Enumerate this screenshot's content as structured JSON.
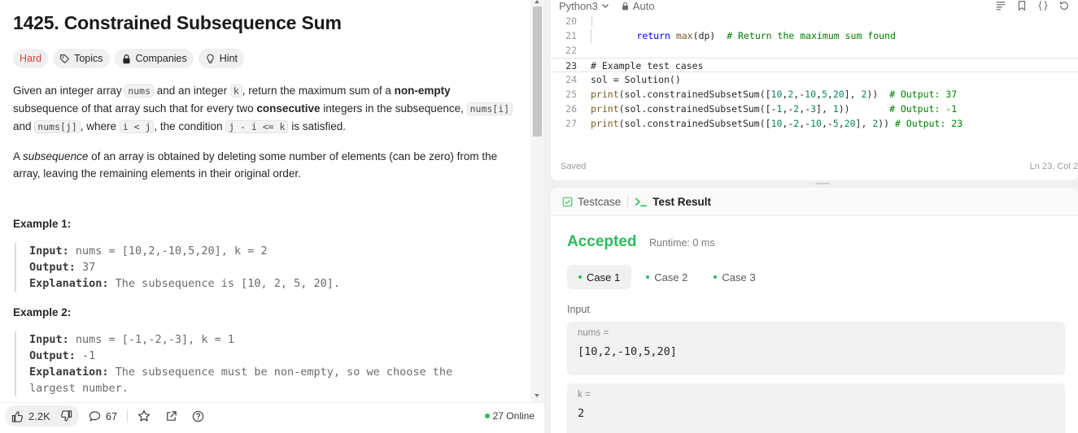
{
  "problem": {
    "title": "1425. Constrained Subsequence Sum",
    "difficulty": "Hard",
    "topics_label": "Topics",
    "companies_label": "Companies",
    "hint_label": "Hint",
    "desc_p1_a": "Given an integer array ",
    "desc_p1_code1": "nums",
    "desc_p1_b": " and an integer ",
    "desc_p1_code2": "k",
    "desc_p1_c": ", return the maximum sum of a ",
    "desc_p1_bold1": "non-empty",
    "desc_p1_d": " subsequence of that array such that for every two ",
    "desc_p1_bold2": "consecutive",
    "desc_p1_e": " integers in the subsequence, ",
    "desc_p1_code3": "nums[i]",
    "desc_p1_f": " and ",
    "desc_p1_code4": "nums[j]",
    "desc_p1_g": ", where ",
    "desc_p1_code5": "i < j",
    "desc_p1_h": ", the condition ",
    "desc_p1_code6": "j - i <= k",
    "desc_p1_i": " is satisfied.",
    "desc_p2_a": "A ",
    "desc_p2_em": "subsequence",
    "desc_p2_b": " of an array is obtained by deleting some number of elements (can be zero) from the array, leaving the remaining elements in their original order.",
    "example1": {
      "title": "Example 1:",
      "input_label": "Input:",
      "input": " nums = [10,2,-10,5,20], k = 2",
      "output_label": "Output:",
      "output": " 37",
      "explanation_label": "Explanation:",
      "explanation": " The subsequence is [10, 2, 5, 20]."
    },
    "example2": {
      "title": "Example 2:",
      "input_label": "Input:",
      "input": " nums = [-1,-2,-3], k = 1",
      "output_label": "Output:",
      "output": " -1",
      "explanation_label": "Explanation:",
      "explanation": " The subsequence must be non-empty, so we choose the",
      "explanation_cont": "largest number."
    }
  },
  "bottom_bar": {
    "likes": "2.2K",
    "comments": "67",
    "online": "27 Online"
  },
  "editor": {
    "language": "Python3",
    "mode": "Auto",
    "saved": "Saved",
    "cursor": "Ln 23, Col 2",
    "lines": [
      {
        "n": "20",
        "t": ""
      },
      {
        "n": "21",
        "t": "        return max(dp)  # Return the maximum sum found"
      },
      {
        "n": "22",
        "t": ""
      },
      {
        "n": "23",
        "t": "# Example test cases"
      },
      {
        "n": "24",
        "t": "sol = Solution()"
      },
      {
        "n": "25",
        "t": "print(sol.constrainedSubsetSum([10,2,-10,5,20], 2))  # Output: 37"
      },
      {
        "n": "26",
        "t": "print(sol.constrainedSubsetSum([-1,-2,-3], 1))       # Output: -1"
      },
      {
        "n": "27",
        "t": "print(sol.constrainedSubsetSum([10,-2,-10,-5,20], 2)) # Output: 23"
      }
    ]
  },
  "result": {
    "tab_testcase": "Testcase",
    "tab_result": "Test Result",
    "status": "Accepted",
    "runtime": "Runtime: 0 ms",
    "cases": [
      "Case 1",
      "Case 2",
      "Case 3"
    ],
    "input_label": "Input",
    "params": [
      {
        "label": "nums =",
        "value": "[10,2,-10,5,20]"
      },
      {
        "label": "k =",
        "value": "2"
      }
    ]
  },
  "colors": {
    "accepted": "#2cbb5d",
    "hard": "#e03e3e",
    "keyword": "#0000ff",
    "comment": "#008000",
    "number": "#098658"
  }
}
